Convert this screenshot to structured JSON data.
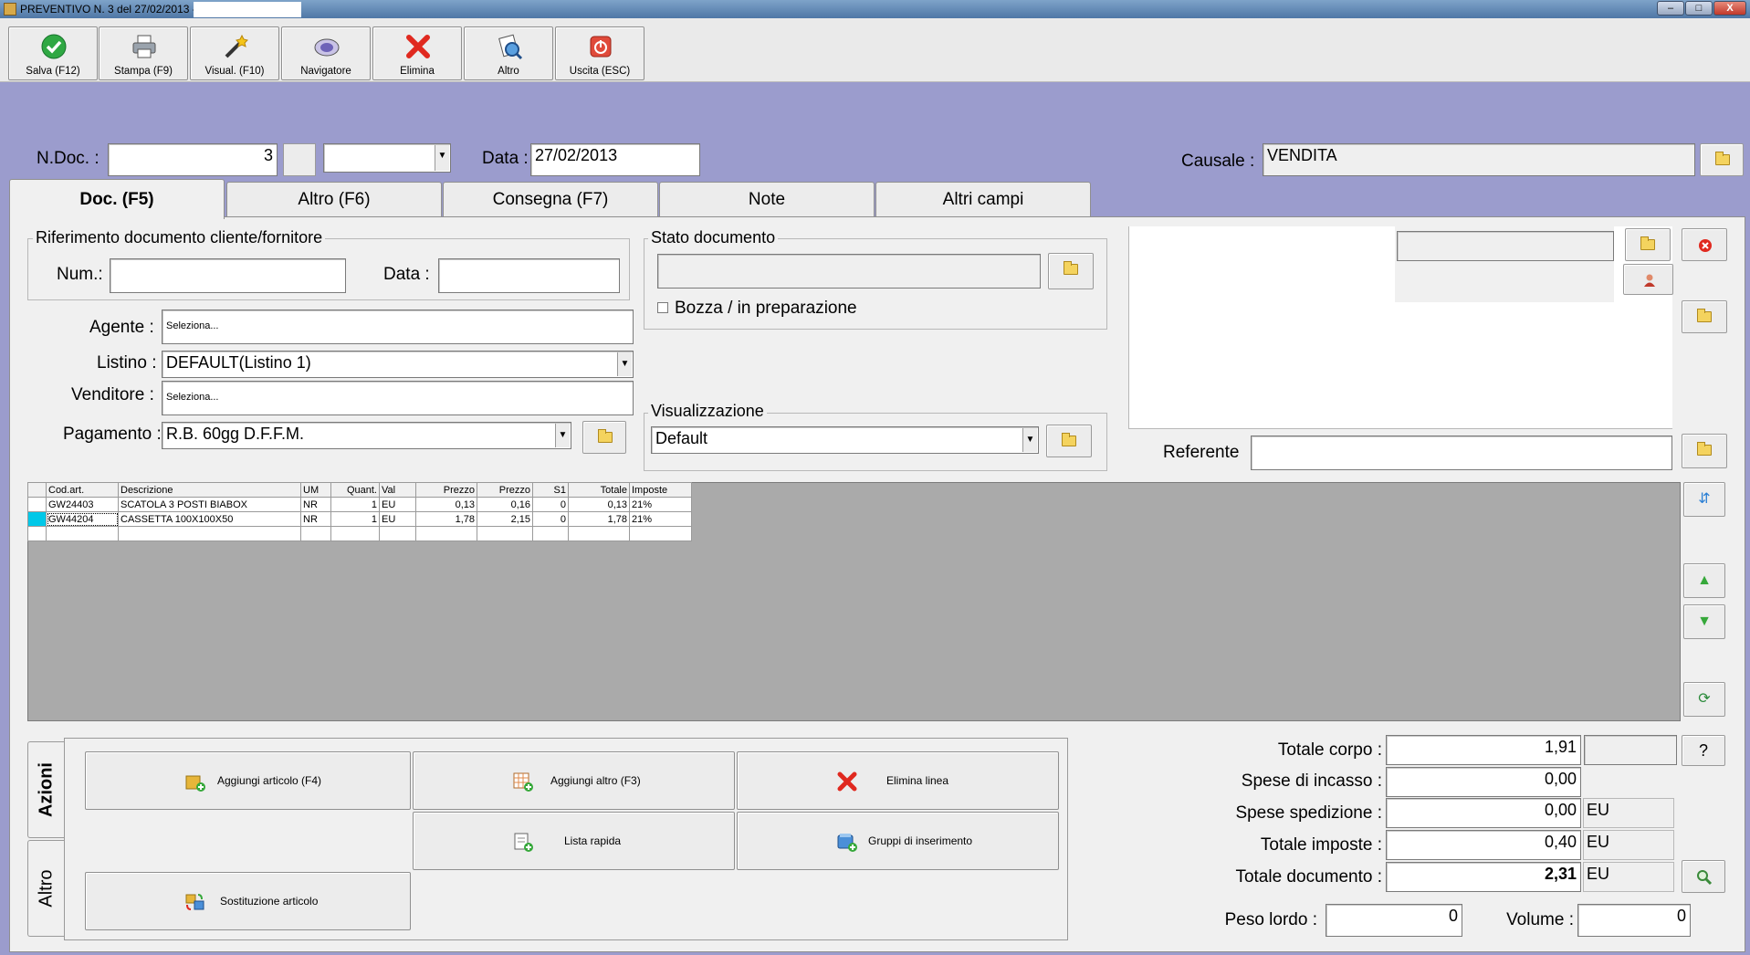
{
  "window": {
    "title": "PREVENTIVO N. 3  del 27/02/2013 -",
    "minimize": "–",
    "maximize": "□",
    "close": "X"
  },
  "toolbar": {
    "save": "Salva (F12)",
    "print": "Stampa (F9)",
    "view": "Visual. (F10)",
    "navigator": "Navigatore",
    "delete": "Elimina",
    "other": "Altro",
    "exit": "Uscita (ESC)"
  },
  "header": {
    "ndoc_label": "N.Doc. :",
    "ndoc_value": "3",
    "ndoc_suffix": "",
    "data_label": "Data :",
    "data_value": "27/02/2013",
    "causale_label": "Causale :",
    "causale_value": "VENDITA"
  },
  "tabs": [
    "Doc. (F5)",
    "Altro (F6)",
    "Consegna (F7)",
    "Note",
    "Altri campi"
  ],
  "riferimento": {
    "title": "Riferimento documento cliente/fornitore",
    "num_label": "Num.:",
    "num_value": "",
    "data_label": "Data :",
    "data_value": ""
  },
  "fields": {
    "agente_label": "Agente :",
    "agente_value": "Seleziona...",
    "listino_label": "Listino :",
    "listino_value": "DEFAULT(Listino 1)",
    "venditore_label": "Venditore :",
    "venditore_value": "Seleziona...",
    "pagamento_label": "Pagamento :",
    "pagamento_value": "R.B. 60gg D.F.F.M."
  },
  "stato": {
    "title": "Stato documento",
    "value": "",
    "bozza_label": "Bozza / in preparazione",
    "bozza_checked": false
  },
  "visualizzazione": {
    "title": "Visualizzazione",
    "value": "Default"
  },
  "referente": {
    "label": "Referente",
    "value": ""
  },
  "grid": {
    "columns": [
      "",
      "Cod.art.",
      "Descrizione",
      "UM",
      "Quant.",
      "Val",
      "Prezzo",
      "Prezzo",
      "S1",
      "Totale",
      "Imposte"
    ],
    "rows": [
      [
        "",
        "GW24403",
        "SCATOLA 3 POSTI BIABOX",
        "NR",
        "1",
        "EU",
        "0,13",
        "0,16",
        "0",
        "0,13",
        "21%"
      ],
      [
        "",
        "GW44204",
        "CASSETTA 100X100X50",
        "NR",
        "1",
        "EU",
        "1,78",
        "2,15",
        "0",
        "1,78",
        "21%"
      ],
      [
        "",
        "",
        "",
        "",
        "",
        "",
        "",
        "",
        "",
        "",
        ""
      ]
    ]
  },
  "side_tabs": {
    "azioni": "Azioni",
    "altro": "Altro"
  },
  "actions": {
    "add_article": "Aggiungi articolo (F4)",
    "add_other": "Aggiungi altro (F3)",
    "delete_line": "Elimina linea",
    "quick_list": "Lista rapida",
    "insert_groups": "Gruppi di inserimento",
    "replace_article": "Sostituzione articolo"
  },
  "totals": {
    "totale_corpo_label": "Totale corpo :",
    "totale_corpo": "1,91",
    "help": "?",
    "spese_incasso_label": "Spese di incasso :",
    "spese_incasso": "0,00",
    "spese_spedizione_label": "Spese spedizione :",
    "spese_spedizione": "0,00",
    "spese_spedizione_unit": "EU",
    "totale_imposte_label": "Totale imposte :",
    "totale_imposte": "0,40",
    "totale_imposte_unit": "EU",
    "totale_documento_label": "Totale documento :",
    "totale_documento": "2,31",
    "totale_documento_unit": "EU",
    "peso_lordo_label": "Peso lordo :",
    "peso_lordo": "0",
    "volume_label": "Volume :",
    "volume": "0"
  }
}
